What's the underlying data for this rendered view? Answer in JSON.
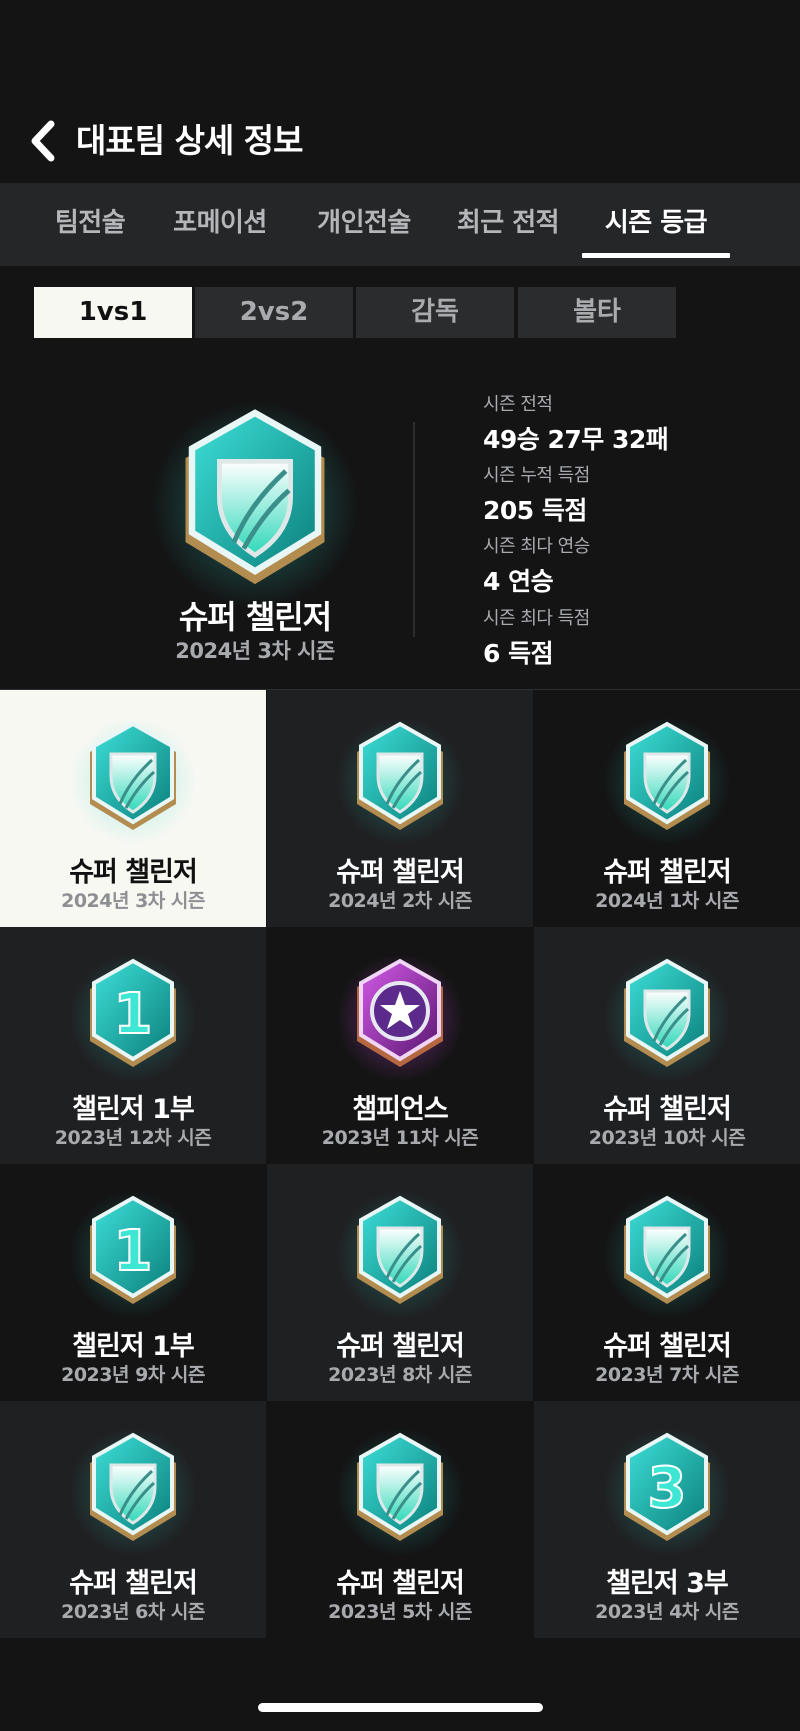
{
  "header": {
    "title": "대표팀 상세 정보",
    "back_icon": "chevron-left-icon"
  },
  "tabs": [
    {
      "label": "팀전술",
      "active": false
    },
    {
      "label": "포메이션",
      "active": false
    },
    {
      "label": "개인전술",
      "active": false
    },
    {
      "label": "최근 전적",
      "active": false
    },
    {
      "label": "시즌 등급",
      "active": true
    }
  ],
  "subtabs": [
    {
      "label": "1vs1",
      "active": true
    },
    {
      "label": "2vs2",
      "active": false
    },
    {
      "label": "감독",
      "active": false
    },
    {
      "label": "볼타",
      "active": false
    }
  ],
  "current": {
    "rank": "슈퍼 챌린저",
    "season": "2024년 3차 시즌",
    "badge": "super-challenger-badge-icon",
    "stats": [
      {
        "label": "시즌 전적",
        "value": "49승 27무 32패"
      },
      {
        "label": "시즌 누적 득점",
        "value": "205 득점"
      },
      {
        "label": "시즌 최다 연승",
        "value": "4 연승"
      },
      {
        "label": "시즌 최다 득점",
        "value": "6 득점"
      }
    ]
  },
  "history": [
    {
      "rank": "슈퍼 챌린저",
      "season": "2024년 3차 시즌",
      "badge": "super-challenger",
      "selected": true
    },
    {
      "rank": "슈퍼 챌린저",
      "season": "2024년 2차 시즌",
      "badge": "super-challenger"
    },
    {
      "rank": "슈퍼 챌린저",
      "season": "2024년 1차 시즌",
      "badge": "super-challenger"
    },
    {
      "rank": "챌린저 1부",
      "season": "2023년 12차 시즌",
      "badge": "challenger",
      "badge_numeral": "1"
    },
    {
      "rank": "챔피언스",
      "season": "2023년 11차 시즌",
      "badge": "champions"
    },
    {
      "rank": "슈퍼 챌린저",
      "season": "2023년 10차 시즌",
      "badge": "super-challenger"
    },
    {
      "rank": "챌린저 1부",
      "season": "2023년 9차 시즌",
      "badge": "challenger",
      "badge_numeral": "1"
    },
    {
      "rank": "슈퍼 챌린저",
      "season": "2023년 8차 시즌",
      "badge": "super-challenger"
    },
    {
      "rank": "슈퍼 챌린저",
      "season": "2023년 7차 시즌",
      "badge": "super-challenger"
    },
    {
      "rank": "슈퍼 챌린저",
      "season": "2023년 6차 시즌",
      "badge": "super-challenger"
    },
    {
      "rank": "슈퍼 챌린저",
      "season": "2023년 5차 시즌",
      "badge": "super-challenger"
    },
    {
      "rank": "챌린저 3부",
      "season": "2023년 4차 시즌",
      "badge": "challenger",
      "badge_numeral": "3"
    }
  ],
  "colors": {
    "background": "#141414",
    "tab_bar": "#252628",
    "badge_teal": "#25c6bf",
    "badge_purple": "#8e2fa8",
    "selected_cell": "#f8f8f2"
  }
}
